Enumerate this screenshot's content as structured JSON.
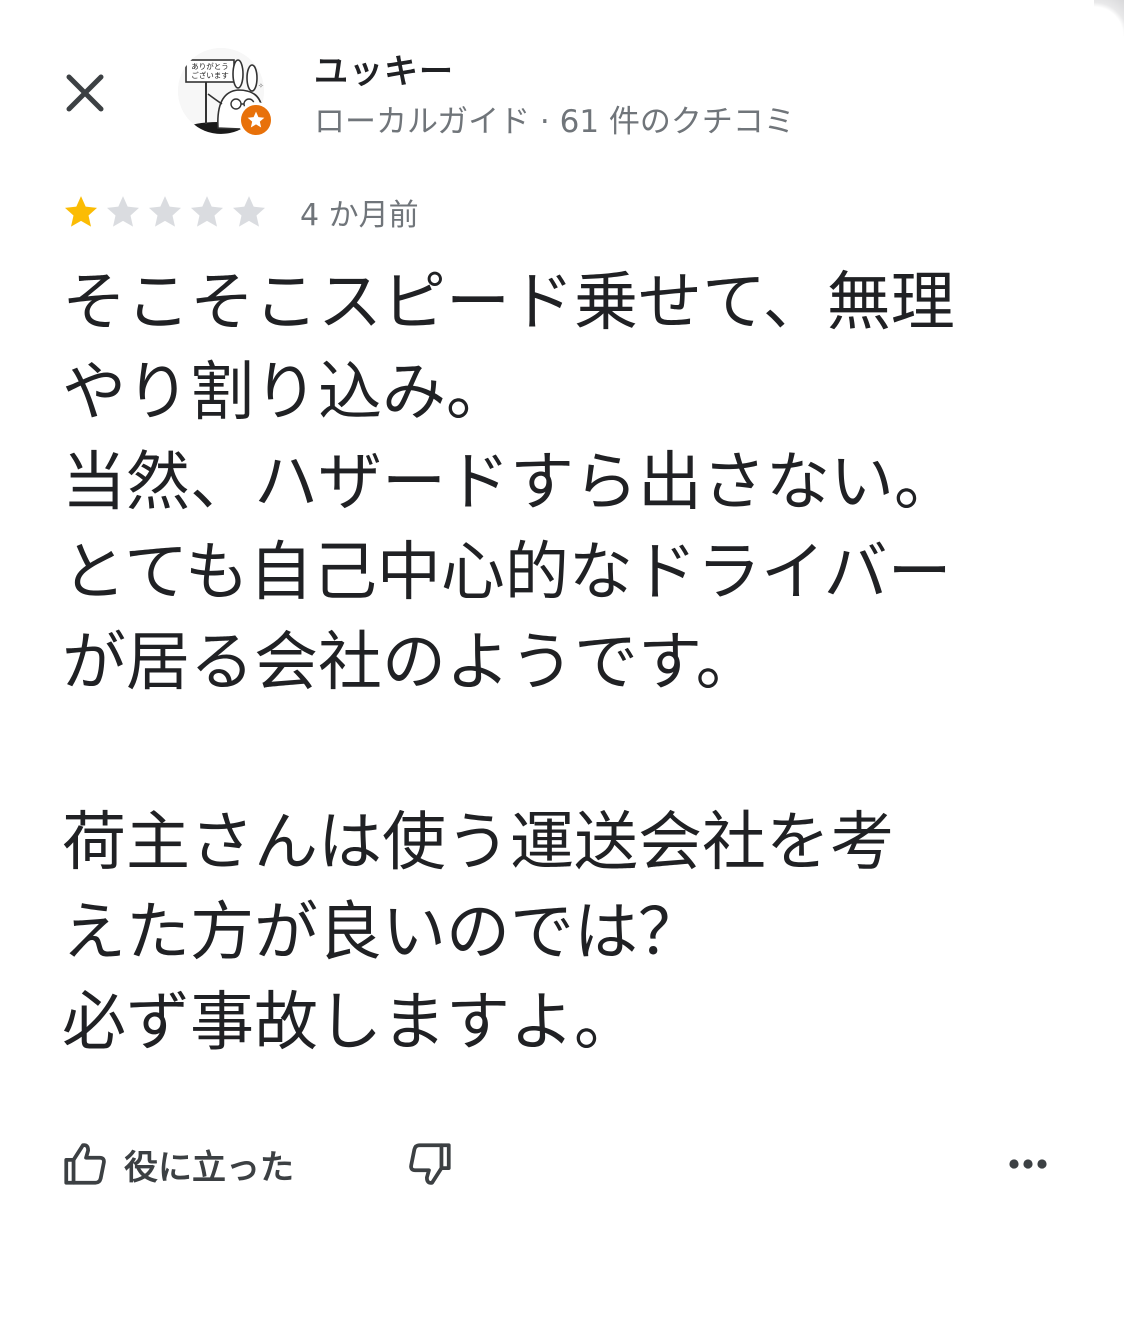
{
  "header": {
    "close_icon": "close-icon",
    "avatar_icon": "avatar-illustration",
    "badge_icon": "local-guide-star-icon",
    "badge_color": "#e8710a",
    "user_name": "ユッキー",
    "user_meta": "ローカルガイド · 61 件のクチコミ"
  },
  "avatar_sign": {
    "line1": "ありがとう",
    "line2": "ございます"
  },
  "review": {
    "rating": 1,
    "max_rating": 5,
    "star_filled_color": "#fbbc04",
    "star_empty_color": "#dadce0",
    "date": "4 か月前",
    "lines": [
      "そこそこスピード乗せて、無理",
      "やり割り込み。",
      "当然、ハザードすら出さない。",
      "とても自己中心的なドライバー",
      "が居る会社のようです。",
      "",
      "荷主さんは使う運送会社を考",
      "えた方が良いのでは？",
      "必ず事故しますよ。"
    ]
  },
  "actions": {
    "helpful_icon": "thumbs-up-icon",
    "helpful_label": "役に立った",
    "dislike_icon": "thumbs-down-icon",
    "more_icon": "more-horizontal-icon"
  }
}
